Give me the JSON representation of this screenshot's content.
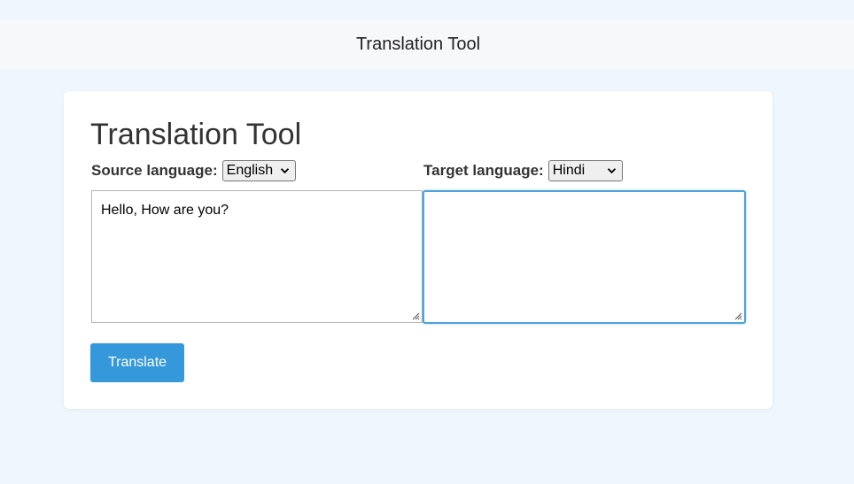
{
  "header": {
    "title": "Translation Tool"
  },
  "card": {
    "title": "Translation Tool",
    "source": {
      "label": "Source language:",
      "selected_language": "English",
      "text": "Hello, How are you?"
    },
    "target": {
      "label": "Target language:",
      "selected_language": "Hindi",
      "text": ""
    },
    "translate_button_label": "Translate"
  },
  "icons": {
    "select_arrow": "chevron-down-icon",
    "textarea_resize": "resize-grip-icon"
  },
  "colors": {
    "page_background": "#eff6fe",
    "header_background": "#f7f8fa",
    "accent": "#3498db",
    "focus_border": "#4ca3d9"
  }
}
